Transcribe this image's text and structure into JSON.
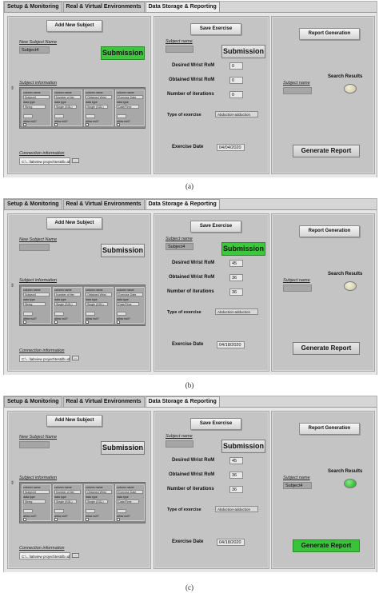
{
  "tabs": [
    "Setup & Monitoring",
    "Real & Virtual Environments",
    "Data Storage & Reporting"
  ],
  "labels": {
    "add_new_subject": "Add New Subject",
    "new_subject_name": "New Subject Name",
    "subject_information": "Subject information",
    "connection_information": "Connection information",
    "save_exercise": "Save Exercise",
    "subject_name": "Subject name",
    "desired_wrist_rom": "Desired Wrist RoM",
    "obtained_wrist_rom": "Obtained Wrist RoM",
    "number_of_iterations": "Number of iterations",
    "type_of_exercise": "Type of exercise",
    "exercise_date": "Exercise Date",
    "report_generation": "Report Generation",
    "search_results": "Search  Results",
    "generate_report": "Generate Report",
    "submission": "Submission",
    "browse": "..."
  },
  "cluster_columns": [
    {
      "name": "column name",
      "value": "Subject4",
      "type_label": "data type",
      "type": "String",
      "allow": "allow null?"
    },
    {
      "name": "column name",
      "value": "Number of iter",
      "type_label": "data type",
      "type": "Single (SGL)",
      "allow": "allow null?"
    },
    {
      "name": "column name",
      "value": "Obtained Wrist",
      "type_label": "data type",
      "type": "Single (SGL)",
      "allow": "allow null?"
    },
    {
      "name": "column name",
      "value": "Exercise Date",
      "type_label": "data type",
      "type": "Date/Time",
      "allow": "allow null?"
    }
  ],
  "panels": [
    {
      "new_subject_value": "Subject4",
      "connection_path": "C:\\...\\labview project\\testdb.udl",
      "subject_name_value": "",
      "desired": "0",
      "obtained": "0",
      "iterations": "0",
      "exercise_type": "Abduction-adduction",
      "date": "04/04/2020",
      "report_subject": "",
      "caption": "(a)"
    },
    {
      "new_subject_value": "",
      "connection_path": "C:\\...\\labview project\\testdb.udl",
      "subject_name_value": "Subject4",
      "desired": "45",
      "obtained": "36",
      "iterations": "36",
      "exercise_type": "Abduction-adduction",
      "date": "04/18/2020",
      "report_subject": "",
      "caption": "(b)"
    },
    {
      "new_subject_value": "",
      "connection_path": "C:\\...\\labview project\\testdb.udl",
      "subject_name_value": "",
      "desired": "45",
      "obtained": "36",
      "iterations": "36",
      "exercise_type": "Abduction-adduction",
      "date": "04/18/2020",
      "report_subject": "Subject4",
      "caption": "(c)"
    }
  ],
  "colors": {
    "submission_active": "#3ec63e",
    "led_on": "#2fc22f",
    "led_off": "#e6e2c4"
  }
}
